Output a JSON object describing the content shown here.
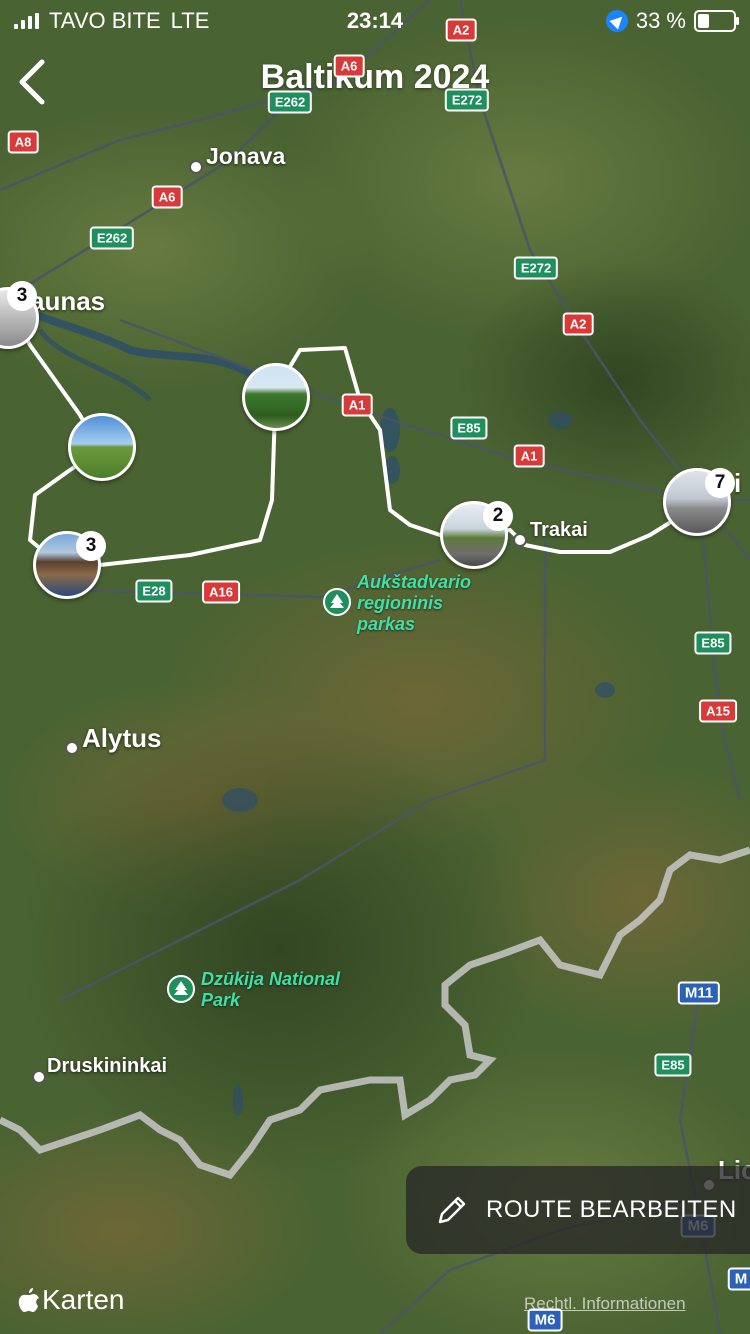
{
  "status_bar": {
    "carrier": "TAVO BITE",
    "network": "LTE",
    "time": "23:14",
    "battery": "33 %",
    "battery_level": 0.33
  },
  "header": {
    "title": "Baltikum 2024"
  },
  "map": {
    "cities": [
      {
        "id": "jonava",
        "name": "Jonava"
      },
      {
        "id": "kaunas",
        "name": "aunas"
      },
      {
        "id": "trakai",
        "name": "Trakai"
      },
      {
        "id": "alytus",
        "name": "Alytus"
      },
      {
        "id": "druskininkai",
        "name": "Druskininkai"
      },
      {
        "id": "vilnius",
        "name": "i"
      },
      {
        "id": "lida",
        "name": "Lic"
      }
    ],
    "parks": [
      {
        "id": "aukstadvario",
        "name": "Aukštadvario regioninis parkas"
      },
      {
        "id": "dzukija",
        "name": "Dzūkija National Park"
      }
    ],
    "roads": [
      {
        "id": "a2-top",
        "label": "A2",
        "kind": "red"
      },
      {
        "id": "a6-top",
        "label": "A6",
        "kind": "red"
      },
      {
        "id": "e262-top",
        "label": "E262",
        "kind": "green"
      },
      {
        "id": "e272-top",
        "label": "E272",
        "kind": "green"
      },
      {
        "id": "a8",
        "label": "A8",
        "kind": "red"
      },
      {
        "id": "a6-mid",
        "label": "A6",
        "kind": "red"
      },
      {
        "id": "e262-mid",
        "label": "E262",
        "kind": "green"
      },
      {
        "id": "e272-mid",
        "label": "E272",
        "kind": "green"
      },
      {
        "id": "a2-mid",
        "label": "A2",
        "kind": "red"
      },
      {
        "id": "a1-left",
        "label": "A1",
        "kind": "red"
      },
      {
        "id": "e85-mid",
        "label": "E85",
        "kind": "green"
      },
      {
        "id": "a1-right",
        "label": "A1",
        "kind": "red"
      },
      {
        "id": "e28",
        "label": "E28",
        "kind": "green"
      },
      {
        "id": "a16",
        "label": "A16",
        "kind": "red"
      },
      {
        "id": "e85-right",
        "label": "E85",
        "kind": "green"
      },
      {
        "id": "a15",
        "label": "A15",
        "kind": "red"
      },
      {
        "id": "m11",
        "label": "M11",
        "kind": "blue"
      },
      {
        "id": "e85-low",
        "label": "E85",
        "kind": "green"
      },
      {
        "id": "m6-a",
        "label": "M6",
        "kind": "blue"
      },
      {
        "id": "m6-b",
        "label": "M6",
        "kind": "blue"
      },
      {
        "id": "m-edge",
        "label": "M",
        "kind": "blue"
      }
    ],
    "photo_stops": [
      {
        "id": "kaunas-stop",
        "count": "3"
      },
      {
        "id": "meadow-stop",
        "count": ""
      },
      {
        "id": "tree-stop",
        "count": ""
      },
      {
        "id": "house-stop",
        "count": "3"
      },
      {
        "id": "trakai-stop",
        "count": "2"
      },
      {
        "id": "vilnius-stop",
        "count": "7"
      }
    ]
  },
  "actions": {
    "edit_route": "ROUTE BEARBEITEN"
  },
  "footer": {
    "brand": "Karten",
    "legal": "Rechtl. Informationen"
  },
  "colors": {
    "route": "#ffffff",
    "border": "#c8c8c8",
    "road_red": "#d83a3a",
    "road_green": "#1f8f5e",
    "road_blue": "#2a62b8"
  }
}
